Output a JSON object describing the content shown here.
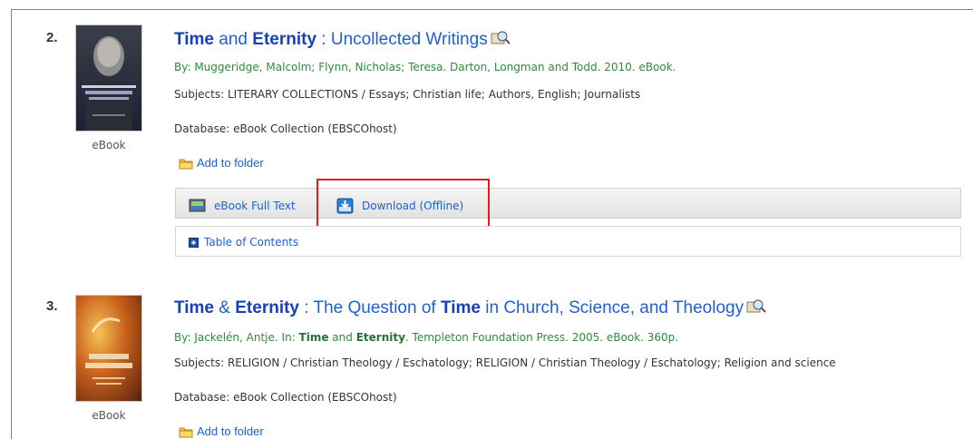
{
  "results": [
    {
      "number": "2.",
      "thumb_label": "eBook",
      "title": {
        "part1": "Time",
        "part2": " and ",
        "part3": "Eternity",
        "part4": " : Uncollected Writings"
      },
      "byline": "By: Muggeridge, Malcolm; Flynn, Nicholas; Teresa. Darton, Longman and Todd. 2010. eBook.",
      "subjects": "Subjects: LITERARY COLLECTIONS / Essays; Christian life; Authors, English; Journalists",
      "database": "Database: eBook Collection (EBSCOhost)",
      "add_to_folder": "Add to folder",
      "links": {
        "full_text": "eBook Full Text",
        "download": "Download (Offline)",
        "toc": "Table of Contents"
      }
    },
    {
      "number": "3.",
      "thumb_label": "eBook",
      "title": {
        "part1": "Time",
        "part2": " & ",
        "part3": "Eternity",
        "part4": " : The Question of ",
        "part5": "Time",
        "part6": " in Church, Science, and Theology"
      },
      "byline": {
        "pre": "By: Jackelén, Antje. In: ",
        "hit1": "Time",
        "mid": " and ",
        "hit2": "Eternity",
        "post": ". Templeton Foundation Press. 2005. eBook. 360p."
      },
      "subjects": "Subjects: RELIGION / Christian Theology / Eschatology; RELIGION / Christian Theology / Eschatology; Religion and science",
      "database": "Database: eBook Collection (EBSCOhost)",
      "add_to_folder": "Add to folder"
    }
  ],
  "colors": {
    "link": "#1e5fd6",
    "byline": "#2e8b3a",
    "highlight": "#e21b1b"
  },
  "icons": [
    "magnify-icon",
    "folder-icon",
    "ebook-full-text-icon",
    "download-icon",
    "table-of-contents-icon"
  ]
}
